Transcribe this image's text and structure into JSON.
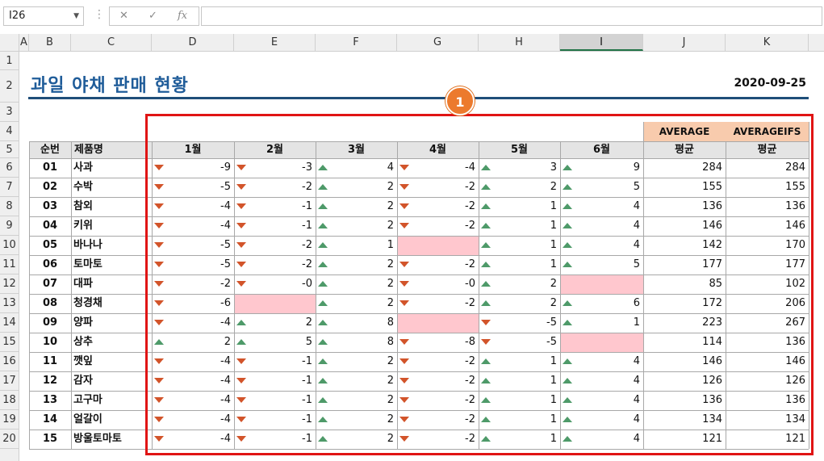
{
  "formula_bar": {
    "name_box": "I26",
    "cancel_icon": "✕",
    "enter_icon": "✓",
    "fx_label": "fx",
    "formula": ""
  },
  "columns": [
    "A",
    "B",
    "C",
    "D",
    "E",
    "F",
    "G",
    "H",
    "I",
    "J",
    "K"
  ],
  "selected_column": "I",
  "rows": [
    "1",
    "2",
    "3",
    "4",
    "5",
    "6",
    "7",
    "8",
    "9",
    "10",
    "11",
    "12",
    "13",
    "14",
    "15",
    "16",
    "17",
    "18",
    "19",
    "20"
  ],
  "title": "과일 야채 판매 현황",
  "date": "2020-09-25",
  "badge": "1",
  "function_labels": {
    "average": "AVERAGE",
    "averageifs": "AVERAGEIFS"
  },
  "headers": [
    "순번",
    "제품명",
    "1월",
    "2월",
    "3월",
    "4월",
    "5월",
    "6월",
    "평균",
    "평균"
  ],
  "table": [
    {
      "no": "01",
      "name": "사과",
      "months": [
        "-9",
        "-3",
        "4",
        "-4",
        "3",
        "9"
      ],
      "avg": "284",
      "avgifs": "284"
    },
    {
      "no": "02",
      "name": "수박",
      "months": [
        "-5",
        "-2",
        "2",
        "-2",
        "2",
        "5"
      ],
      "avg": "155",
      "avgifs": "155"
    },
    {
      "no": "03",
      "name": "참외",
      "months": [
        "-4",
        "-1",
        "2",
        "-2",
        "1",
        "4"
      ],
      "avg": "136",
      "avgifs": "136"
    },
    {
      "no": "04",
      "name": "키위",
      "months": [
        "-4",
        "-1",
        "2",
        "-2",
        "1",
        "4"
      ],
      "avg": "146",
      "avgifs": "146"
    },
    {
      "no": "05",
      "name": "바나나",
      "months": [
        "-5",
        "-2",
        "1",
        "",
        "1",
        "4"
      ],
      "avg": "142",
      "avgifs": "170"
    },
    {
      "no": "06",
      "name": "토마토",
      "months": [
        "-5",
        "-2",
        "2",
        "-2",
        "1",
        "5"
      ],
      "avg": "177",
      "avgifs": "177"
    },
    {
      "no": "07",
      "name": "대파",
      "months": [
        "-2",
        "-0",
        "2",
        "-0",
        "2",
        ""
      ],
      "avg": "85",
      "avgifs": "102"
    },
    {
      "no": "08",
      "name": "청경채",
      "months": [
        "-6",
        "",
        "2",
        "-2",
        "2",
        "6"
      ],
      "avg": "172",
      "avgifs": "206"
    },
    {
      "no": "09",
      "name": "양파",
      "months": [
        "-4",
        "2",
        "8",
        "",
        "-5",
        "1"
      ],
      "avg": "223",
      "avgifs": "267"
    },
    {
      "no": "10",
      "name": "상추",
      "months": [
        "2",
        "5",
        "8",
        "-8",
        "-5",
        ""
      ],
      "avg": "114",
      "avgifs": "136"
    },
    {
      "no": "11",
      "name": "깻잎",
      "months": [
        "-4",
        "-1",
        "2",
        "-2",
        "1",
        "4"
      ],
      "avg": "146",
      "avgifs": "146"
    },
    {
      "no": "12",
      "name": "감자",
      "months": [
        "-4",
        "-1",
        "2",
        "-2",
        "1",
        "4"
      ],
      "avg": "126",
      "avgifs": "126"
    },
    {
      "no": "13",
      "name": "고구마",
      "months": [
        "-4",
        "-1",
        "2",
        "-2",
        "1",
        "4"
      ],
      "avg": "136",
      "avgifs": "136"
    },
    {
      "no": "14",
      "name": "얼갈이",
      "months": [
        "-4",
        "-1",
        "2",
        "-2",
        "1",
        "4"
      ],
      "avg": "134",
      "avgifs": "134"
    },
    {
      "no": "15",
      "name": "방울토마토",
      "months": [
        "-4",
        "-1",
        "2",
        "-2",
        "1",
        "4"
      ],
      "avg": "121",
      "avgifs": "121"
    }
  ],
  "colors": {
    "title": "#1f5c99",
    "frame": "#e01414",
    "badge": "#ec7a2d",
    "up": "#4e9a69",
    "down": "#d2542a",
    "empty_highlight": "#ffc7ce",
    "function_header": "#f8cbad"
  },
  "icons": {
    "up": "triangle-up-icon",
    "down": "triangle-down-icon"
  }
}
